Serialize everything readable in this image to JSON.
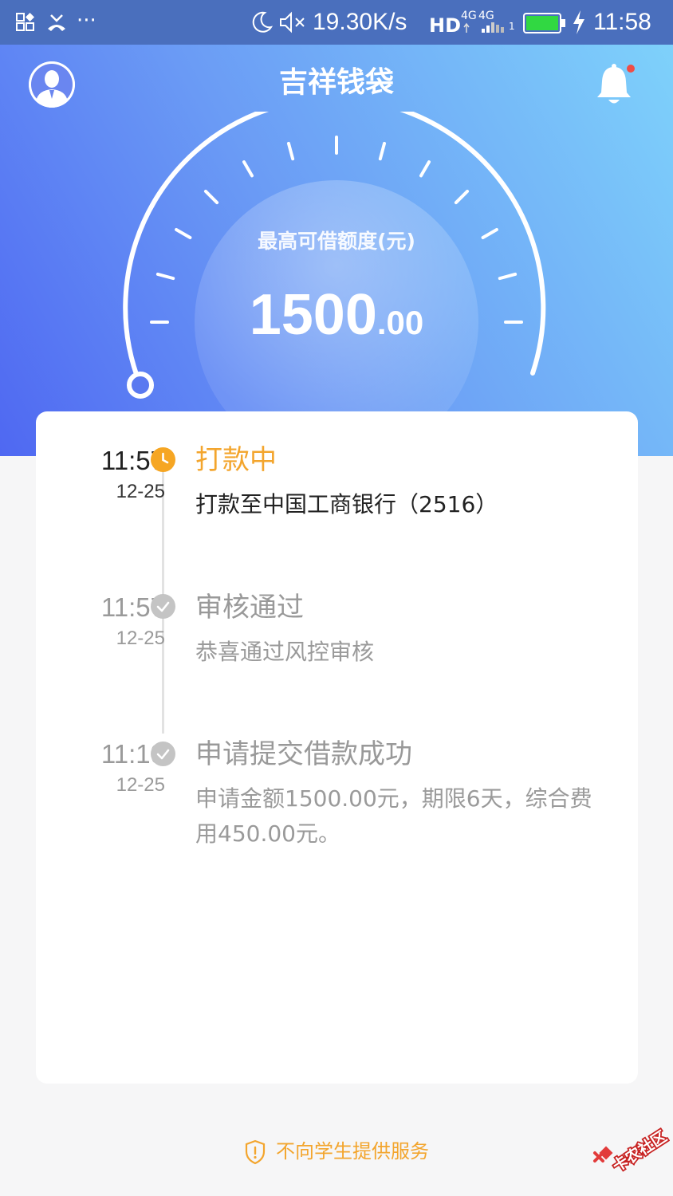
{
  "status_bar": {
    "net_speed": "19.30K/s",
    "hd": "HD",
    "net_type_1": "4G",
    "net_type_2": "4G",
    "sim": "1",
    "time": "11:58",
    "more": "···"
  },
  "header": {
    "title": "吉祥钱袋"
  },
  "gauge": {
    "label": "最高可借额度(元)",
    "amount_int": "1500",
    "amount_dec": ".00"
  },
  "timeline": [
    {
      "time": "11:57",
      "date": "12-25",
      "title": "打款中",
      "desc": "打款至中国工商银行（2516）",
      "state": "active"
    },
    {
      "time": "11:57",
      "date": "12-25",
      "title": "审核通过",
      "desc": "恭喜通过风控审核",
      "state": "done"
    },
    {
      "time": "11:19",
      "date": "12-25",
      "title": "申请提交借款成功",
      "desc": "申请金额1500.00元，期限6天，综合费用450.00元。",
      "state": "done"
    }
  ],
  "footer": {
    "notice": "不向学生提供服务"
  },
  "watermark": {
    "text": "卡农社区"
  },
  "colors": {
    "accent": "#f3a52d",
    "header_start": "#4f68f2",
    "header_end": "#7fd4fb",
    "muted": "#999999",
    "done_dot": "#c2c2c2"
  },
  "icons": [
    "avatar-icon",
    "bell-icon",
    "clock-icon",
    "check-icon",
    "shield-icon"
  ]
}
